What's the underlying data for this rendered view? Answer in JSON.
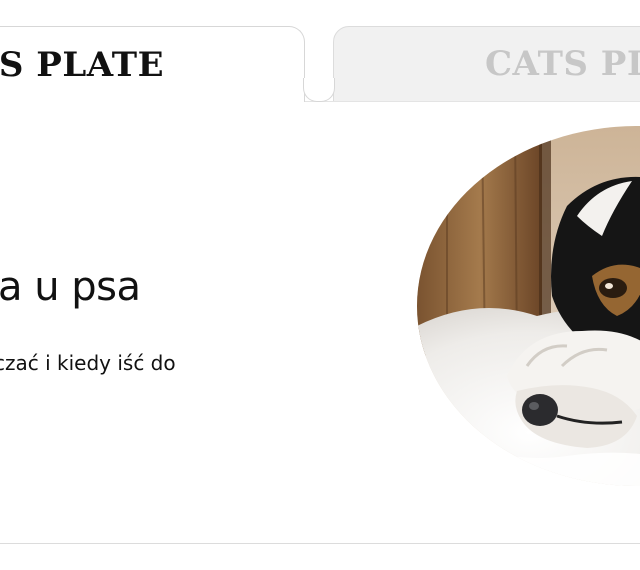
{
  "tabs": [
    {
      "label": "GS PLATE",
      "state": "active"
    },
    {
      "label": "CATS PL",
      "state": "inactive"
    }
  ],
  "card": {
    "title": "a u psa",
    "description": "czać i kiedy iść do",
    "image": "dog-lying-on-fur-rug-photo"
  },
  "colors": {
    "active_tab_text": "#111111",
    "inactive_tab_text": "#c7c7c7",
    "inactive_tab_bg": "#f1f1f1",
    "border": "#d7d7d7"
  }
}
